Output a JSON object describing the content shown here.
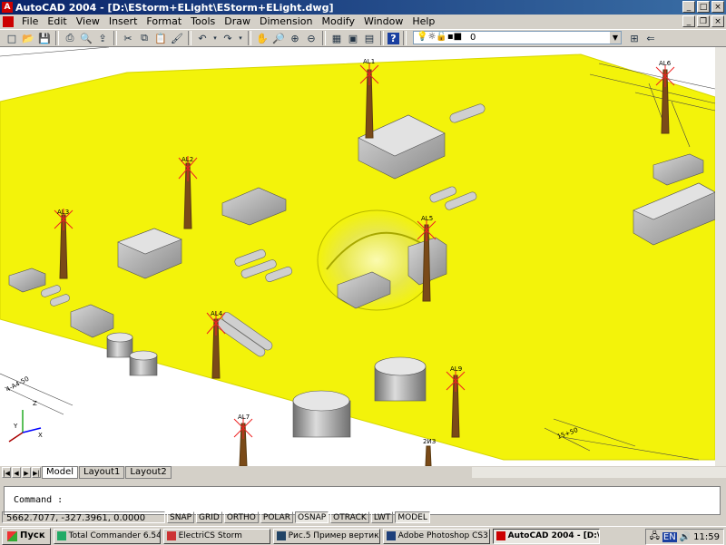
{
  "window": {
    "title": "AutoCAD 2004 - [D:\\EStorm+ELight\\EStorm+ELight.dwg]"
  },
  "menu": [
    "File",
    "Edit",
    "View",
    "Insert",
    "Format",
    "Tools",
    "Draw",
    "Dimension",
    "Modify",
    "Window",
    "Help"
  ],
  "layer": {
    "value": "0"
  },
  "scene": {
    "masts": [
      "AL1",
      "AL2",
      "AL3",
      "AL4",
      "AL5",
      "AL6",
      "AL7",
      "AL9",
      "2ИЗ"
    ],
    "annotations": [
      "4-А4-50",
      "15+50"
    ]
  },
  "tabs": [
    "Model",
    "Layout1",
    "Layout2"
  ],
  "command": {
    "prompt": "Command :"
  },
  "status": {
    "coords": "5662.7077, -327.3961, 0.0000",
    "toggles": [
      "SNAP",
      "GRID",
      "ORTHO",
      "POLAR",
      "OSNAP",
      "OTRACK",
      "LWT",
      "MODEL"
    ]
  },
  "taskbar": {
    "start": "Пуск",
    "tasks": [
      "Total Commander 6.54 -...",
      "ElectriCS Storm",
      "Рис.5 Пример вертикал...",
      "Adobe Photoshop CS3 E...",
      "AutoCAD 2004 - [D:\\E..."
    ],
    "lang": "EN",
    "clock": "11:59"
  },
  "colors": {
    "ground": "#f3f30a",
    "accent": "#0a246a"
  }
}
